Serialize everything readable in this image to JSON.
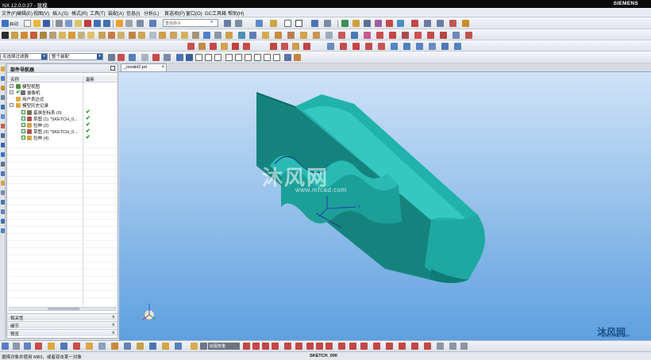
{
  "window": {
    "title": "NX 12.0.0.27 - 建模",
    "brand": "SIEMENS"
  },
  "menu": [
    "文件(F)",
    "编辑(E)",
    "视图(V)",
    "插入(S)",
    "格式(R)",
    "工具(T)",
    "装配(A)",
    "信息(I)",
    "分析(L)",
    "首选项(P)",
    "窗口(O)",
    "GC工具箱",
    "帮助(H)"
  ],
  "toolbar": {
    "start_label": "启动",
    "search_placeholder": "查找命令"
  },
  "selection": {
    "filter": "无选择过滤器",
    "scope": "整个装配"
  },
  "nav": {
    "title": "部件导航器",
    "col_name": "名称",
    "col_latest": "最新",
    "rows": [
      {
        "label": "模型视图",
        "level": 0,
        "expander": "+",
        "check": false,
        "ok": false
      },
      {
        "label": "摄像机",
        "level": 0,
        "expander": "+",
        "check": true,
        "ok": false
      },
      {
        "label": "用户表达式",
        "level": 0,
        "expander": "",
        "check": false,
        "ok": false
      },
      {
        "label": "模型历史记录",
        "level": 0,
        "expander": "−",
        "check": false,
        "ok": false
      },
      {
        "label": "基准坐标系 (0)",
        "level": 1,
        "expander": "",
        "check": true,
        "ok": true
      },
      {
        "label": "草图 (1) \"SKETCH_0...",
        "level": 1,
        "expander": "",
        "check": true,
        "ok": true
      },
      {
        "label": "拉伸 (2)",
        "level": 1,
        "expander": "",
        "check": true,
        "ok": true
      },
      {
        "label": "草图 (3) \"SKETCH_0...",
        "level": 1,
        "expander": "",
        "check": true,
        "ok": true
      },
      {
        "label": "拉伸 (4)",
        "level": 1,
        "expander": "",
        "check": true,
        "ok": true
      }
    ],
    "subpanels": [
      "相关性",
      "细节",
      "预览"
    ],
    "subpanel_toggle": "∨"
  },
  "graphics": {
    "tab_label": "_model2.prt",
    "tab_close": "×",
    "triad_label": "Y"
  },
  "watermark": {
    "text": "沐风网",
    "url": "www.mfcad.com",
    "corner_text": "沐风网",
    "corner_url": "www.mfcad.com"
  },
  "bottom_toolbar": {
    "mode_label": "绘图变量"
  },
  "status": {
    "left": "選择对象并使用 MB3，或者双击某一对象",
    "center": "SKETCH_000"
  },
  "colors": {
    "part": "#27b3ad",
    "part_dark": "#0f6f6a",
    "background_top": "#cfe2f7",
    "background_bottom": "#5ea0e0",
    "check_green": "#1d9a1d"
  }
}
